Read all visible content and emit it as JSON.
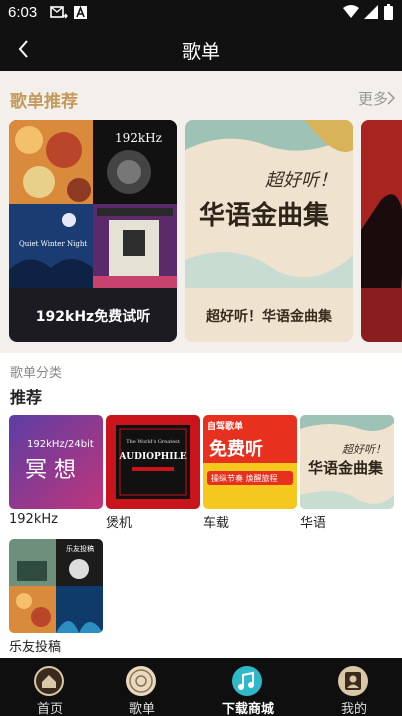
{
  "status_bar": {
    "time": "6:03"
  },
  "app_bar": {
    "title": "歌单"
  },
  "recommend": {
    "title": "歌单推荐",
    "more_label": "更多",
    "cards": [
      {
        "label": "192kHz免费试听",
        "art_text": "192kHz",
        "art_text_2": "Quiet Winter Night"
      },
      {
        "label": "超好听！华语金曲集",
        "art_text": "超好听！",
        "art_text_2": "华语金曲集"
      },
      {
        "label": ""
      }
    ]
  },
  "categories": {
    "subtitle": "歌单分类",
    "section_title": "推荐",
    "tiles": [
      {
        "label": "192kHz",
        "art_text": "192kHz/24bit",
        "art_text_2": "冥 想"
      },
      {
        "label": "煲机",
        "art_text": "The World's Greatest",
        "art_text_2": "AUDIOPHILE"
      },
      {
        "label": "车载",
        "art_text": "自驾歌单",
        "art_text_2": "免费听",
        "art_text_3": "操纵节奏 焕醒旅程"
      },
      {
        "label": "华语",
        "art_text": "超好听！",
        "art_text_2": "华语金曲集"
      },
      {
        "label": "乐友投稿",
        "art_text": "乐友投稿"
      }
    ]
  },
  "bottom_nav": {
    "items": [
      {
        "label": "首页",
        "icon": "home-icon"
      },
      {
        "label": "歌单",
        "icon": "playlist-icon"
      },
      {
        "label": "下载商城",
        "icon": "music-store-icon",
        "active": true
      },
      {
        "label": "我的",
        "icon": "profile-icon"
      }
    ]
  },
  "colors": {
    "accent": "#c49a5c",
    "nav_active": "#2fb8c8",
    "background_band": "#f3efea"
  }
}
